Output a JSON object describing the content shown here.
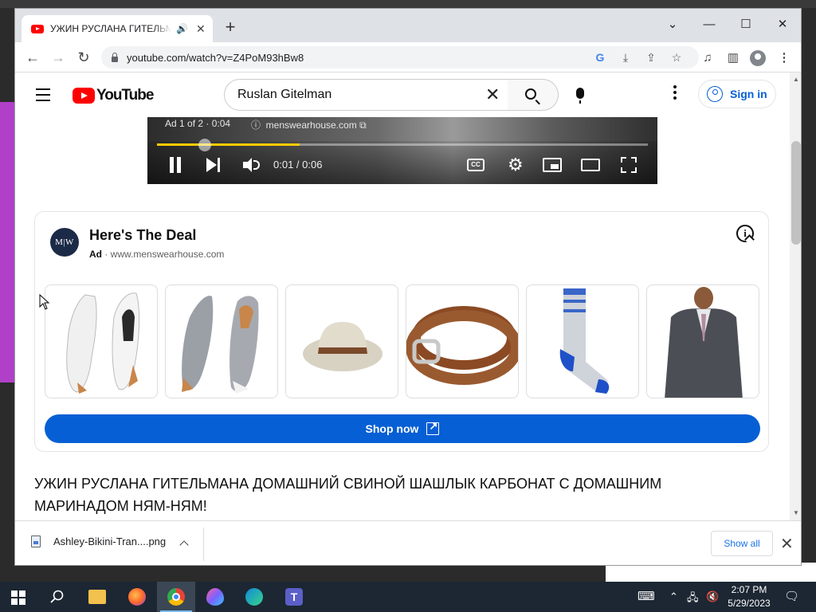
{
  "browser": {
    "tab_title": "УЖИН РУСЛАНА ГИТЕЛЬМАНА ДОМАШНИЙ СВИНОЙ ШАШЛЫК",
    "url": "youtube.com/watch?v=Z4PoM93hBw8"
  },
  "youtube": {
    "logo_text": "YouTube",
    "search_query": "Ruslan Gitelman",
    "signin_label": "Sign in"
  },
  "player": {
    "ad_info": "Ad 1 of 2 · 0:04",
    "ad_domain": "menswearhouse.com",
    "time": "0:01 / 0:06",
    "cc_label": "CC",
    "progress_fraction": 0.29
  },
  "ad_card": {
    "logo_text": "M|W",
    "title": "Here's The Deal",
    "ad_badge": "Ad",
    "domain": "· www.menswearhouse.com",
    "products": [
      "white-sneaker",
      "gray-sneaker",
      "bucket-hat",
      "brown-belt",
      "striped-sock",
      "gray-suit"
    ],
    "shop_label": "Shop now"
  },
  "video": {
    "title": "УЖИН РУСЛАНА ГИТЕЛЬМАНА ДОМАШНИЙ СВИНОЙ ШАШЛЫК КАРБОНАТ С ДОМАШНИМ МАРИНАДОМ НЯМ-НЯМ!"
  },
  "downloads": {
    "file_name": "Ashley-Bikini-Tran....png",
    "show_all_label": "Show all"
  },
  "taskbar": {
    "time": "2:07 PM",
    "date": "5/29/2023"
  },
  "colors": {
    "youtube_red": "#ff0000",
    "link_blue": "#065fd4",
    "progress_yellow": "#ffcc00"
  }
}
